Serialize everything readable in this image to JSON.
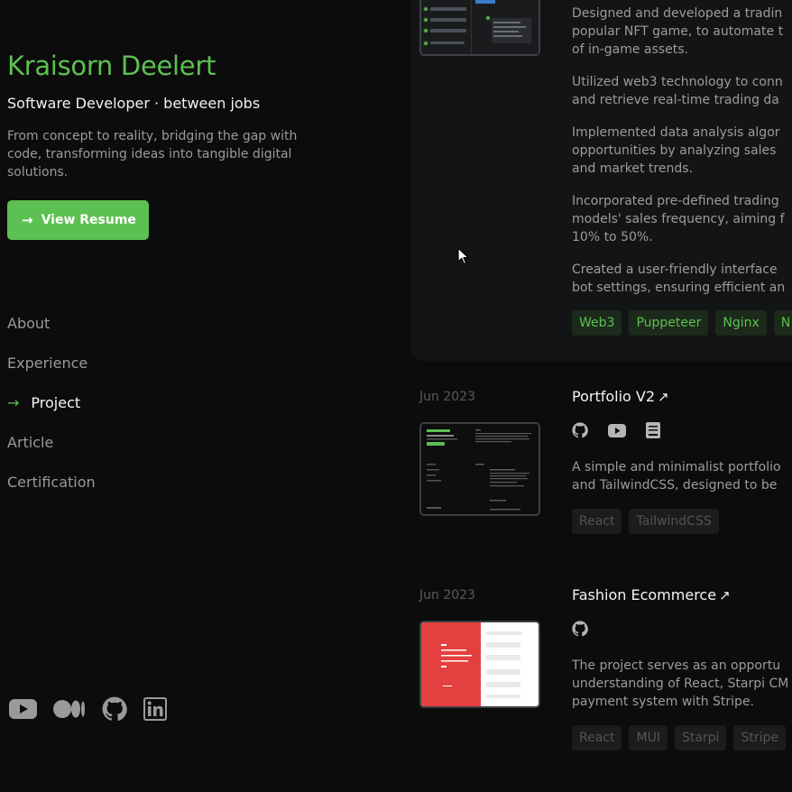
{
  "profile": {
    "name": "Kraisorn Deelert",
    "role": "Software Developer · between jobs",
    "tagline": "From concept to reality, bridging the gap with code, transforming ideas into tangible digital solutions.",
    "resume_label": "View Resume"
  },
  "nav": {
    "items": [
      {
        "label": "About"
      },
      {
        "label": "Experience"
      },
      {
        "label": "Project",
        "active": true
      },
      {
        "label": "Article"
      },
      {
        "label": "Certification"
      }
    ]
  },
  "socials": [
    "youtube-icon",
    "medium-icon",
    "github-icon",
    "linkedin-icon"
  ],
  "projects": [
    {
      "lines": [
        "Designed and developed a tradin",
        "popular NFT game, to automate t",
        "of in-game assets.",
        "Utilized web3 technology to conn",
        "and retrieve real-time trading da",
        "Implemented data analysis algor",
        "opportunities by analyzing sales",
        "and market trends.",
        "Incorporated pre-defined trading",
        "models' sales frequency, aiming f",
        "10% to 50%.",
        "Created a user-friendly interface",
        "bot settings, ensuring efficient an"
      ],
      "tags": [
        "Web3",
        "Puppeteer",
        "Nginx",
        "N"
      ]
    },
    {
      "date": "Jun 2023",
      "title": "Portfolio V2",
      "icons": [
        "github-icon",
        "youtube-icon",
        "book-icon"
      ],
      "lines": [
        "A simple and minimalist portfolio",
        "and TailwindCSS, designed to be"
      ],
      "tags": [
        "React",
        "TailwindCSS"
      ]
    },
    {
      "date": "Jun 2023",
      "title": "Fashion Ecommerce",
      "icons": [
        "github-icon"
      ],
      "lines": [
        "The project serves as an opportu",
        "understanding of React, Starpi CM",
        "payment system with Stripe."
      ],
      "tags": [
        "React",
        "MUI",
        "Starpi",
        "Stripe"
      ]
    }
  ],
  "colors": {
    "accent": "#5cc052",
    "background": "#0c0c0c",
    "card": "#131416"
  }
}
